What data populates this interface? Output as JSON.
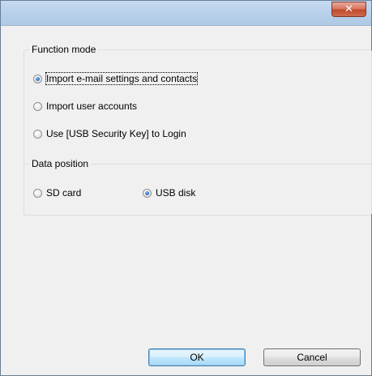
{
  "window": {
    "close_glyph": "✕"
  },
  "function_mode": {
    "title": "Function mode",
    "options": [
      {
        "label": "Import e-mail settings and contacts",
        "checked": true
      },
      {
        "label": "Import user accounts",
        "checked": false
      },
      {
        "label": "Use [USB Security Key] to Login",
        "checked": false
      }
    ]
  },
  "data_position": {
    "title": "Data position",
    "options": [
      {
        "label": "SD card",
        "checked": false
      },
      {
        "label": "USB disk",
        "checked": true
      }
    ]
  },
  "buttons": {
    "ok_label": "OK",
    "cancel_label": "Cancel"
  },
  "colors": {
    "titlebar": "#b9d1ea",
    "close_button": "#c14a2f",
    "dialog_background": "#f0f0f0",
    "radio_checked": "#2a6fc0"
  }
}
